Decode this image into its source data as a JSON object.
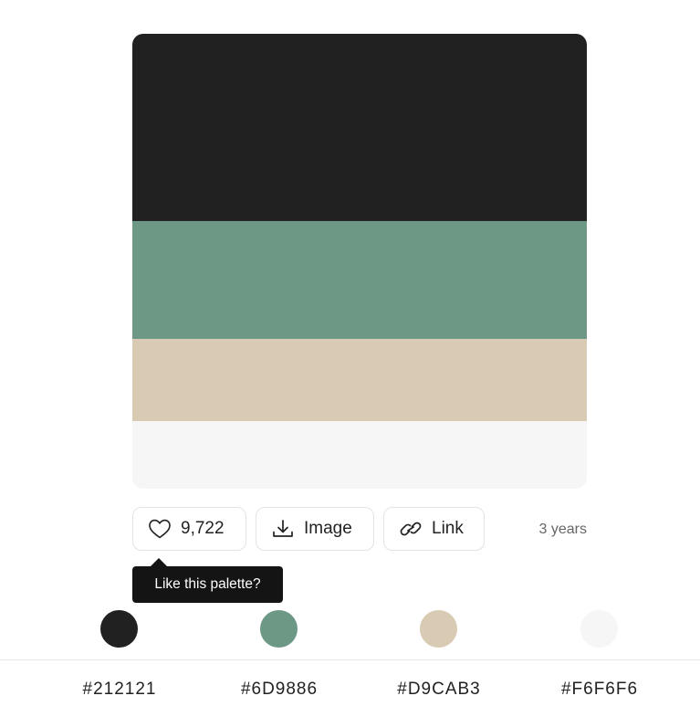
{
  "palette": {
    "colors": [
      {
        "hex": "#212121",
        "label": "#212121"
      },
      {
        "hex": "#6D9886",
        "label": "#6D9886"
      },
      {
        "hex": "#D9CAB3",
        "label": "#D9CAB3"
      },
      {
        "hex": "#F6F6F6",
        "label": "#F6F6F6"
      }
    ]
  },
  "actions": {
    "like_count": "9,722",
    "image_label": "Image",
    "link_label": "Link",
    "age": "3 years"
  },
  "tooltip": {
    "text": "Like this palette?"
  },
  "icons": {
    "like": "heart-icon",
    "image": "download-icon",
    "link": "link-icon"
  }
}
